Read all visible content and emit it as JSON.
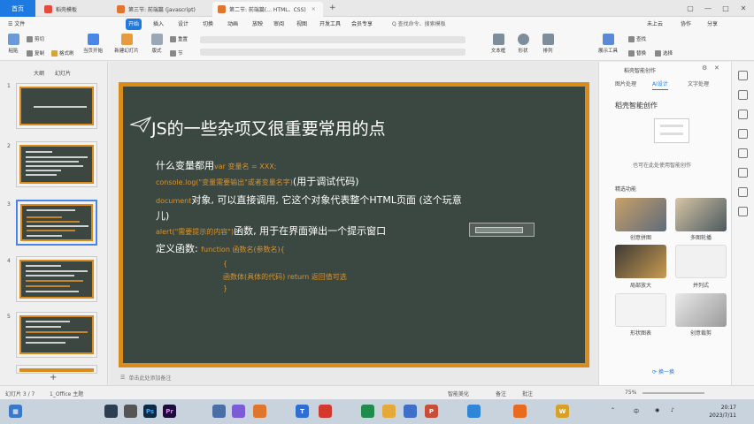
{
  "titlebar": {
    "home": "首页",
    "tabs": [
      {
        "label": "稻壳模板",
        "color": "#e64a3c",
        "active": false
      },
      {
        "label": "第三节: 前端篇 (javascript)",
        "color": "#e0752e",
        "active": false
      },
      {
        "label": "第二节: 前端篇(... HTML、CSS)",
        "color": "#e0752e",
        "active": true
      }
    ],
    "new_tab": "+"
  },
  "menu": {
    "file": "文件",
    "items": [
      "开始",
      "插入",
      "设计",
      "切换",
      "动画",
      "放映",
      "审阅",
      "视图",
      "开发工具",
      "会员专享",
      "Q 查找命令、搜索模板"
    ],
    "active_index": 0,
    "cloud": "未上云",
    "collab": "协作",
    "share": "分享"
  },
  "ribbon": {
    "paste": "粘贴",
    "cut": "剪切",
    "copy": "复制",
    "format_painter": "格式刷",
    "from_current": "当页开始",
    "new_slide": "新建幻灯片",
    "layout": "版式",
    "section": "节",
    "reset": "重置",
    "textbox": "文本框",
    "shape": "形状",
    "arrange": "排列",
    "display_tools": "展示工具",
    "find": "查找",
    "replace": "替换",
    "select": "选择"
  },
  "leftpanel": {
    "tabs": [
      "大纲",
      "幻灯片"
    ],
    "slide_numbers": [
      "1",
      "2",
      "3",
      "4",
      "5"
    ],
    "active_slide": 2,
    "add": "+"
  },
  "slide": {
    "title": "JS的一些杂项又很重要常用的点",
    "line1_label": "什么变量都用",
    "line1_code": "var 变量名 = XXX;",
    "line2_code": "console.log(\"变量需要输出\"或者变量名字)",
    "line2_label": "(用于调试代码)",
    "line3_code": "document",
    "line3_label": "对象, 可以直接调用, 它这个对象代表整个HTML页面 (这个玩意",
    "line3_cont": "儿)",
    "line4_code": "alert(\"需要提示的内容\")",
    "line4_label": "函数, 用于在界面弹出一个提示窗口",
    "line5_label": "定义函数:",
    "line5_code": "function 函数名(参数名){",
    "code_open": "{",
    "code_body": "函数体(具体的代码)  return 返回值可选",
    "code_close": "}"
  },
  "notes_placeholder": "单击此处添加备注",
  "rightpanel": {
    "header": "稻壳智能创作",
    "tabs": [
      "图片处理",
      "AI设计",
      "文字处理"
    ],
    "active_tab": 1,
    "section_title": "稻壳智能创作",
    "hint": "也可在此处使用智能创作",
    "features_title": "精选功能",
    "features": [
      "创意拼图",
      "多图轮播",
      "局部放大",
      "并列式",
      "形状图表",
      "创意裁剪"
    ],
    "refresh": "换一换"
  },
  "statusbar": {
    "slide_info": "幻灯片 3 / 7",
    "theme": "1_Office 主题",
    "smart_beautify": "智能美化",
    "notes": "备注",
    "comments": "批注",
    "zoom": "75%"
  },
  "taskbar": {
    "apps": [
      "Ps",
      "Pr",
      "T",
      "P",
      "W"
    ],
    "ime": "中",
    "time": "20:17",
    "date": "2023/7/11"
  },
  "colors": {
    "accent": "#1e7ae0",
    "slide_border": "#d98c1c",
    "slide_bg": "#3b4842",
    "code": "#d9922b"
  }
}
